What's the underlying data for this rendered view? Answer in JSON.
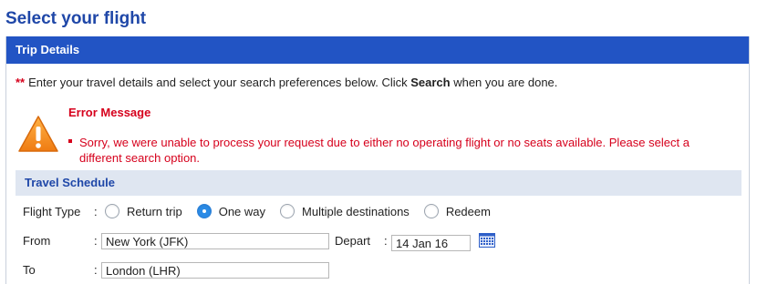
{
  "page_title": "Select your flight",
  "panel": {
    "title": "Trip Details"
  },
  "intro": {
    "stars": "**",
    "text_before": "Enter your travel details and select your search preferences below. Click ",
    "bold": "Search",
    "text_after": " when you are done."
  },
  "error": {
    "title": "Error Message",
    "message": "Sorry, we were unable to process your request due to either no operating flight or no seats available. Please select a different search option."
  },
  "schedule": {
    "title": "Travel Schedule",
    "flight_type": {
      "label": "Flight Type",
      "colon": ":",
      "options": [
        "Return trip",
        "One way",
        "Multiple destinations",
        "Redeem"
      ],
      "selected": "One way"
    },
    "from": {
      "label": "From",
      "colon": ":",
      "value": "New York (JFK)"
    },
    "depart": {
      "label": "Depart",
      "colon": ":",
      "value": "14 Jan 16"
    },
    "to": {
      "label": "To",
      "colon": ":",
      "value": "London (LHR)"
    }
  },
  "colors": {
    "title_blue": "#1f47a8",
    "header_blue": "#2254c4",
    "error_red": "#d6001c",
    "warning_orange": "#f08a1c"
  },
  "icons": {
    "warning": "warning-triangle-icon",
    "calendar": "calendar-icon"
  }
}
